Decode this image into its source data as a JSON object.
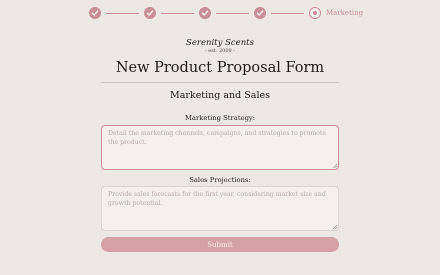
{
  "stepper": {
    "steps_completed": 4,
    "current_step_label": "Marketing"
  },
  "header": {
    "brand": "Serenity Scents",
    "established": "- est. 2009 -",
    "title": "New Product Proposal Form"
  },
  "section": {
    "heading": "Marketing and Sales"
  },
  "fields": {
    "marketing_strategy": {
      "label": "Marketing Strategy:",
      "value": "",
      "placeholder": "Detail the marketing channels, campaigns, and strategies to promote the product."
    },
    "sales_projections": {
      "label": "Sales Projections:",
      "value": "",
      "placeholder": "Provide sales forecasts for the first year, considering market size and growth potential."
    }
  },
  "submit": {
    "label": "Submit"
  },
  "colors": {
    "accent": "#c98e97",
    "button": "#d6a2a8",
    "background": "#ede8e5"
  }
}
